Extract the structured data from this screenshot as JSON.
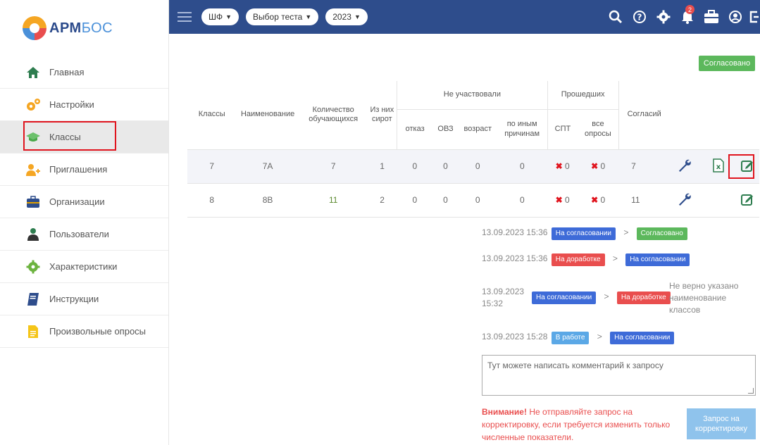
{
  "logo": {
    "part1": "АРМ",
    "part2": "БОС"
  },
  "sidebar": {
    "items": [
      {
        "label": "Главная",
        "icon": "home-icon"
      },
      {
        "label": "Настройки",
        "icon": "gears-icon"
      },
      {
        "label": "Классы",
        "icon": "graduation-cap-icon",
        "active": true
      },
      {
        "label": "Приглашения",
        "icon": "user-add-icon"
      },
      {
        "label": "Организации",
        "icon": "briefcase-icon"
      },
      {
        "label": "Пользователи",
        "icon": "user-icon"
      },
      {
        "label": "Характеристики",
        "icon": "gear-icon"
      },
      {
        "label": "Инструкции",
        "icon": "book-icon"
      },
      {
        "label": "Произвольные опросы",
        "icon": "document-icon"
      }
    ]
  },
  "topbar": {
    "filters": [
      {
        "label": "ШФ"
      },
      {
        "label": "Выбор теста"
      },
      {
        "label": "2023"
      }
    ],
    "notification_count": "2"
  },
  "status_button": "Согласовано",
  "table": {
    "headers": {
      "classes": "Классы",
      "name": "Наименование",
      "students": "Количество обучающихся",
      "orphans": "Из них сирот",
      "not_participated": "Не участвовали",
      "refusal": "отказ",
      "ovz": "ОВЗ",
      "age": "возраст",
      "other": "по иным причинам",
      "passed": "Прошедших",
      "spt": "СПТ",
      "all_surveys": "все опросы",
      "consents": "Согласий"
    },
    "rows": [
      {
        "cls": "7",
        "name": "7А",
        "students": "7",
        "orphans": "1",
        "refusal": "0",
        "ovz": "0",
        "age": "0",
        "other": "0",
        "spt": "0",
        "all": "0",
        "consents": "7"
      },
      {
        "cls": "8",
        "name": "8В",
        "students": "11",
        "orphans": "2",
        "refusal": "0",
        "ovz": "0",
        "age": "0",
        "other": "0",
        "spt": "0",
        "all": "0",
        "consents": "11"
      }
    ]
  },
  "history": [
    {
      "time": "13.09.2023 15:36",
      "from": "На согласовании",
      "to": "Согласовано"
    },
    {
      "time": "13.09.2023 15:36",
      "from": "На доработке",
      "to": "На согласовании"
    },
    {
      "time_l1": "13.09.2023",
      "time_l2": "15:32",
      "from": "На согласовании",
      "to": "На доработке",
      "note_l1": "Не верно указано",
      "note_l2": "наименование",
      "note_l3": "классов"
    },
    {
      "time": "13.09.2023 15:28",
      "from": "В работе",
      "to": "На согласовании"
    }
  ],
  "arrow": ">",
  "comment_placeholder": "Тут можете написать комментарий к запросу",
  "warning": {
    "bold": "Внимание!",
    "text": " Не отправляйте запрос на корректировку, если требуется изменить только численные показатели."
  },
  "request_button": {
    "line1": "Запрос на",
    "line2": "корректировку"
  },
  "colors": {
    "topbar": "#2e4d8c",
    "green": "#5cb85c",
    "blue_tag": "#3e6bd8",
    "red_tag": "#e94e4e",
    "highlight": "#e0141e"
  }
}
